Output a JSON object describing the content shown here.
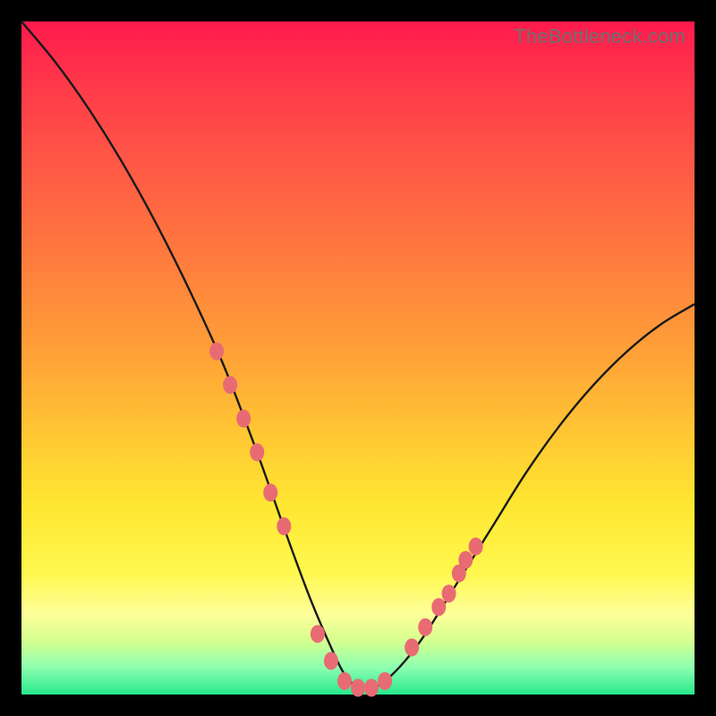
{
  "watermark": "TheBottleneck.com",
  "colors": {
    "frame": "#000000",
    "curve": "#1a1a1a",
    "marker": "#e86b74",
    "gradient_stops": [
      "#ff1a4d",
      "#ff3b4a",
      "#ff5a45",
      "#ff7b3e",
      "#ffa337",
      "#ffc933",
      "#ffe732",
      "#fff84f",
      "#fdff9a",
      "#d6ff8f",
      "#8cffb0",
      "#28e88c"
    ]
  },
  "chart_data": {
    "type": "line",
    "title": "",
    "xlabel": "",
    "ylabel": "",
    "xlim": [
      0,
      100
    ],
    "ylim": [
      0,
      100
    ],
    "grid": false,
    "legend": false,
    "series": [
      {
        "name": "bottleneck-curve",
        "x": [
          0,
          5,
          10,
          15,
          20,
          25,
          30,
          35,
          40,
          43,
          46,
          48,
          50,
          52,
          54,
          57,
          60,
          65,
          70,
          75,
          80,
          85,
          90,
          95,
          100
        ],
        "values": [
          100,
          94,
          87,
          79,
          70,
          60,
          49,
          36,
          22,
          14,
          7,
          3,
          1,
          1,
          2,
          5,
          9,
          17,
          25,
          33,
          40,
          46,
          51,
          55,
          58
        ]
      }
    ],
    "markers": {
      "name": "highlight-points",
      "x": [
        29,
        31,
        33,
        35,
        37,
        39,
        44,
        46,
        48,
        50,
        52,
        54,
        58,
        60,
        62,
        63.5,
        65,
        66,
        67.5
      ],
      "values": [
        51,
        46,
        41,
        36,
        30,
        25,
        9,
        5,
        2,
        1,
        1,
        2,
        7,
        10,
        13,
        15,
        18,
        20,
        22
      ]
    }
  }
}
